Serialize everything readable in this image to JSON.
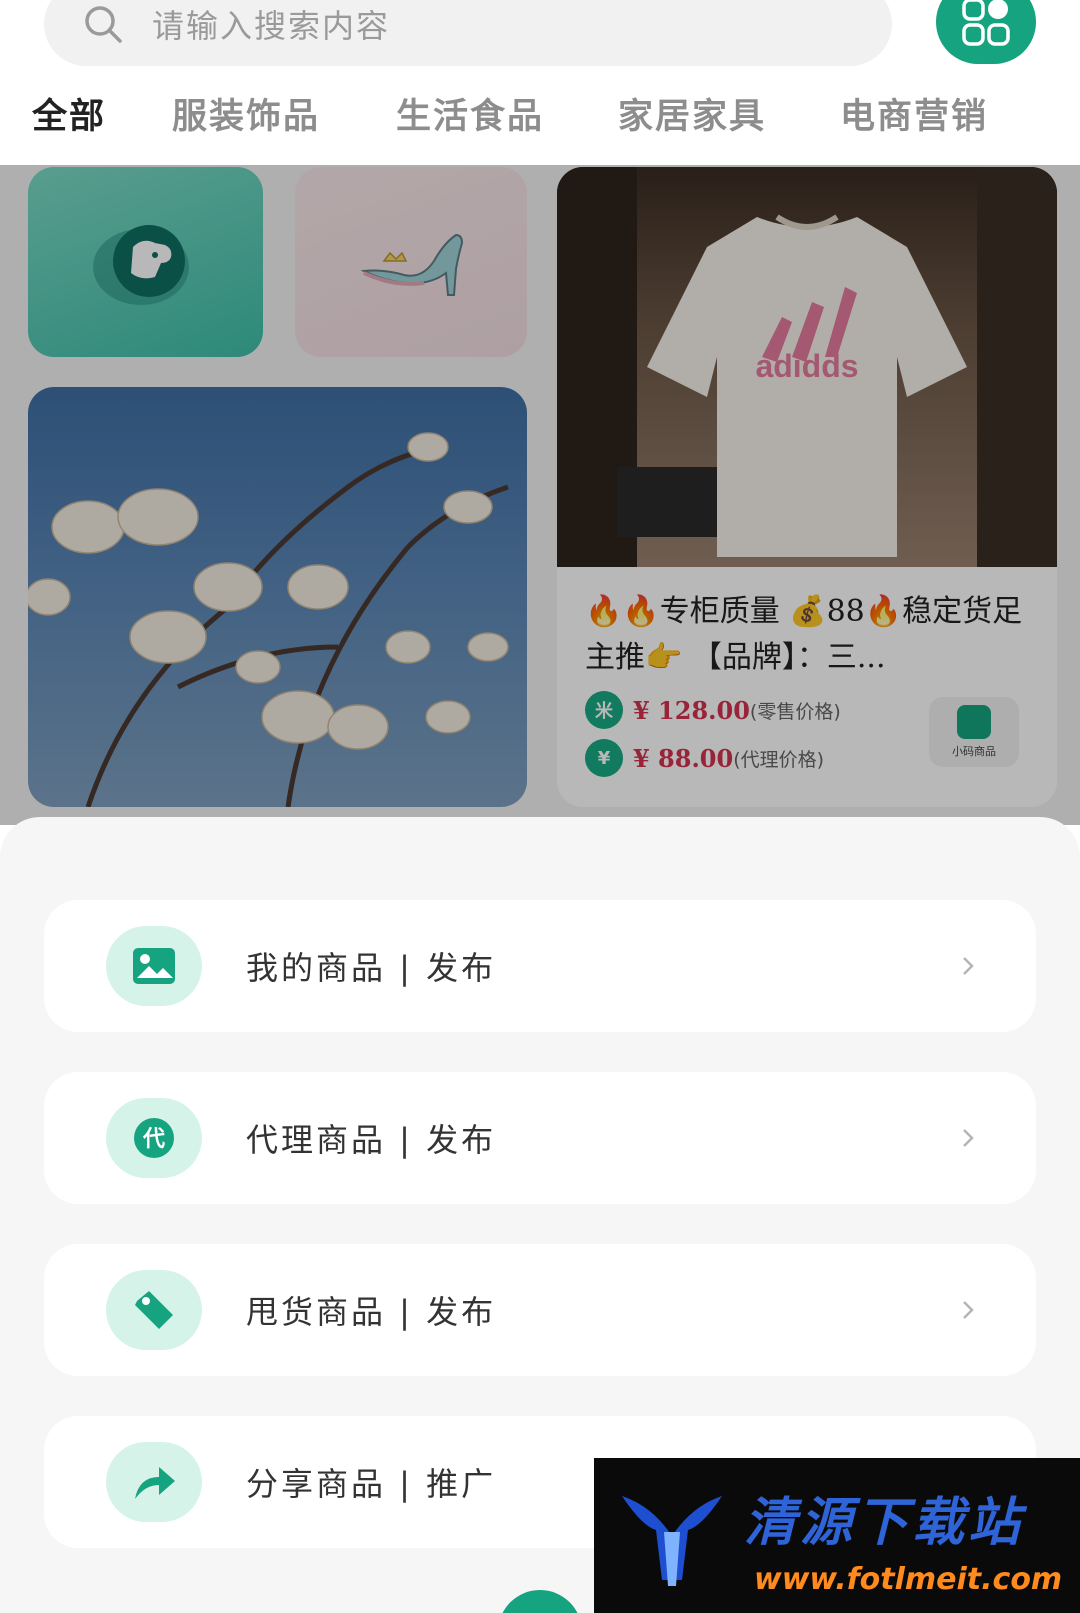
{
  "search": {
    "placeholder": "请输入搜索内容"
  },
  "tabs": [
    "全部",
    "服装饰品",
    "生活食品",
    "家居家具",
    "电商营销"
  ],
  "product": {
    "title": "🔥🔥专柜质量 💰88🔥稳定货足 主推👉 【品牌】：三...",
    "retail_price": "¥ 128.00",
    "retail_note": "(零售价格)",
    "agent_price": "¥ 88.00",
    "agent_note": "(代理价格)",
    "mini_label": "小码商品",
    "shirt_text": "adidds"
  },
  "menu": [
    {
      "label": "我的商品 | 发布",
      "icon": "image-icon"
    },
    {
      "label": "代理商品 | 发布",
      "icon": "agent-icon"
    },
    {
      "label": "甩货商品 | 发布",
      "icon": "tag-icon"
    },
    {
      "label": "分享商品 | 推广",
      "icon": "share-icon"
    }
  ],
  "watermark": {
    "title": "清源下载站",
    "url": "www.fotlmeit.com"
  },
  "colors": {
    "accent": "#16a37f",
    "price": "#d3324f",
    "icon_bg": "#d6f3ea"
  }
}
